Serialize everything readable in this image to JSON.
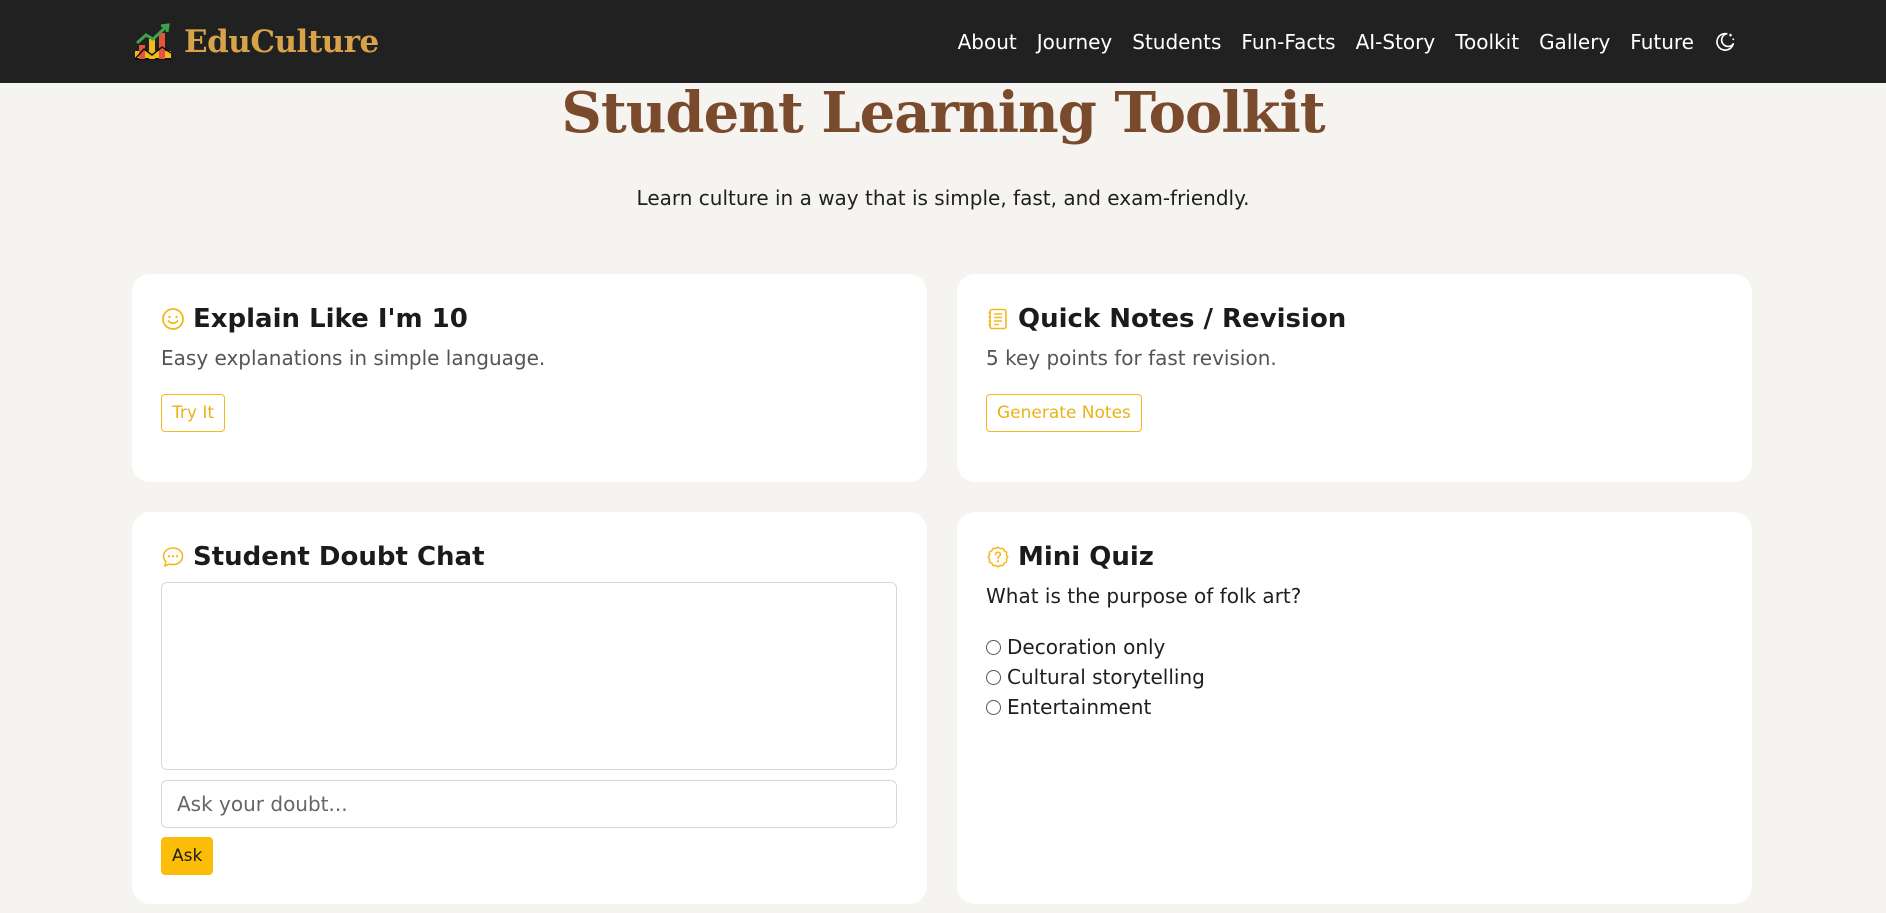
{
  "brand": {
    "name": "EduCulture",
    "icon": "chart-growth-icon"
  },
  "nav": {
    "items": [
      "About",
      "Journey",
      "Students",
      "Fun-Facts",
      "AI-Story",
      "Toolkit",
      "Gallery",
      "Future"
    ],
    "theme_toggle_icon": "moon-icon"
  },
  "header": {
    "title": "Student Learning Toolkit",
    "subtitle": "Learn culture in a way that is simple, fast, and exam-friendly."
  },
  "cards": {
    "explain": {
      "icon": "smile-icon",
      "title": "Explain Like I'm 10",
      "description": "Easy explanations in simple language.",
      "button": "Try It"
    },
    "notes": {
      "icon": "notes-icon",
      "title": "Quick Notes / Revision",
      "description": "5 key points for fast revision.",
      "button": "Generate Notes"
    },
    "chat": {
      "icon": "chat-icon",
      "title": "Student Doubt Chat",
      "input_placeholder": "Ask your doubt...",
      "input_value": "",
      "button": "Ask"
    },
    "quiz": {
      "icon": "question-icon",
      "title": "Mini Quiz",
      "question": "What is the purpose of folk art?",
      "options": [
        "Decoration only",
        "Cultural storytelling",
        "Entertainment"
      ]
    }
  },
  "colors": {
    "navbar_bg": "#212121",
    "brand": "#d7a24a",
    "title": "#7a4a2c",
    "accent": "#fbbd08",
    "page_bg": "#f6f4f1"
  }
}
